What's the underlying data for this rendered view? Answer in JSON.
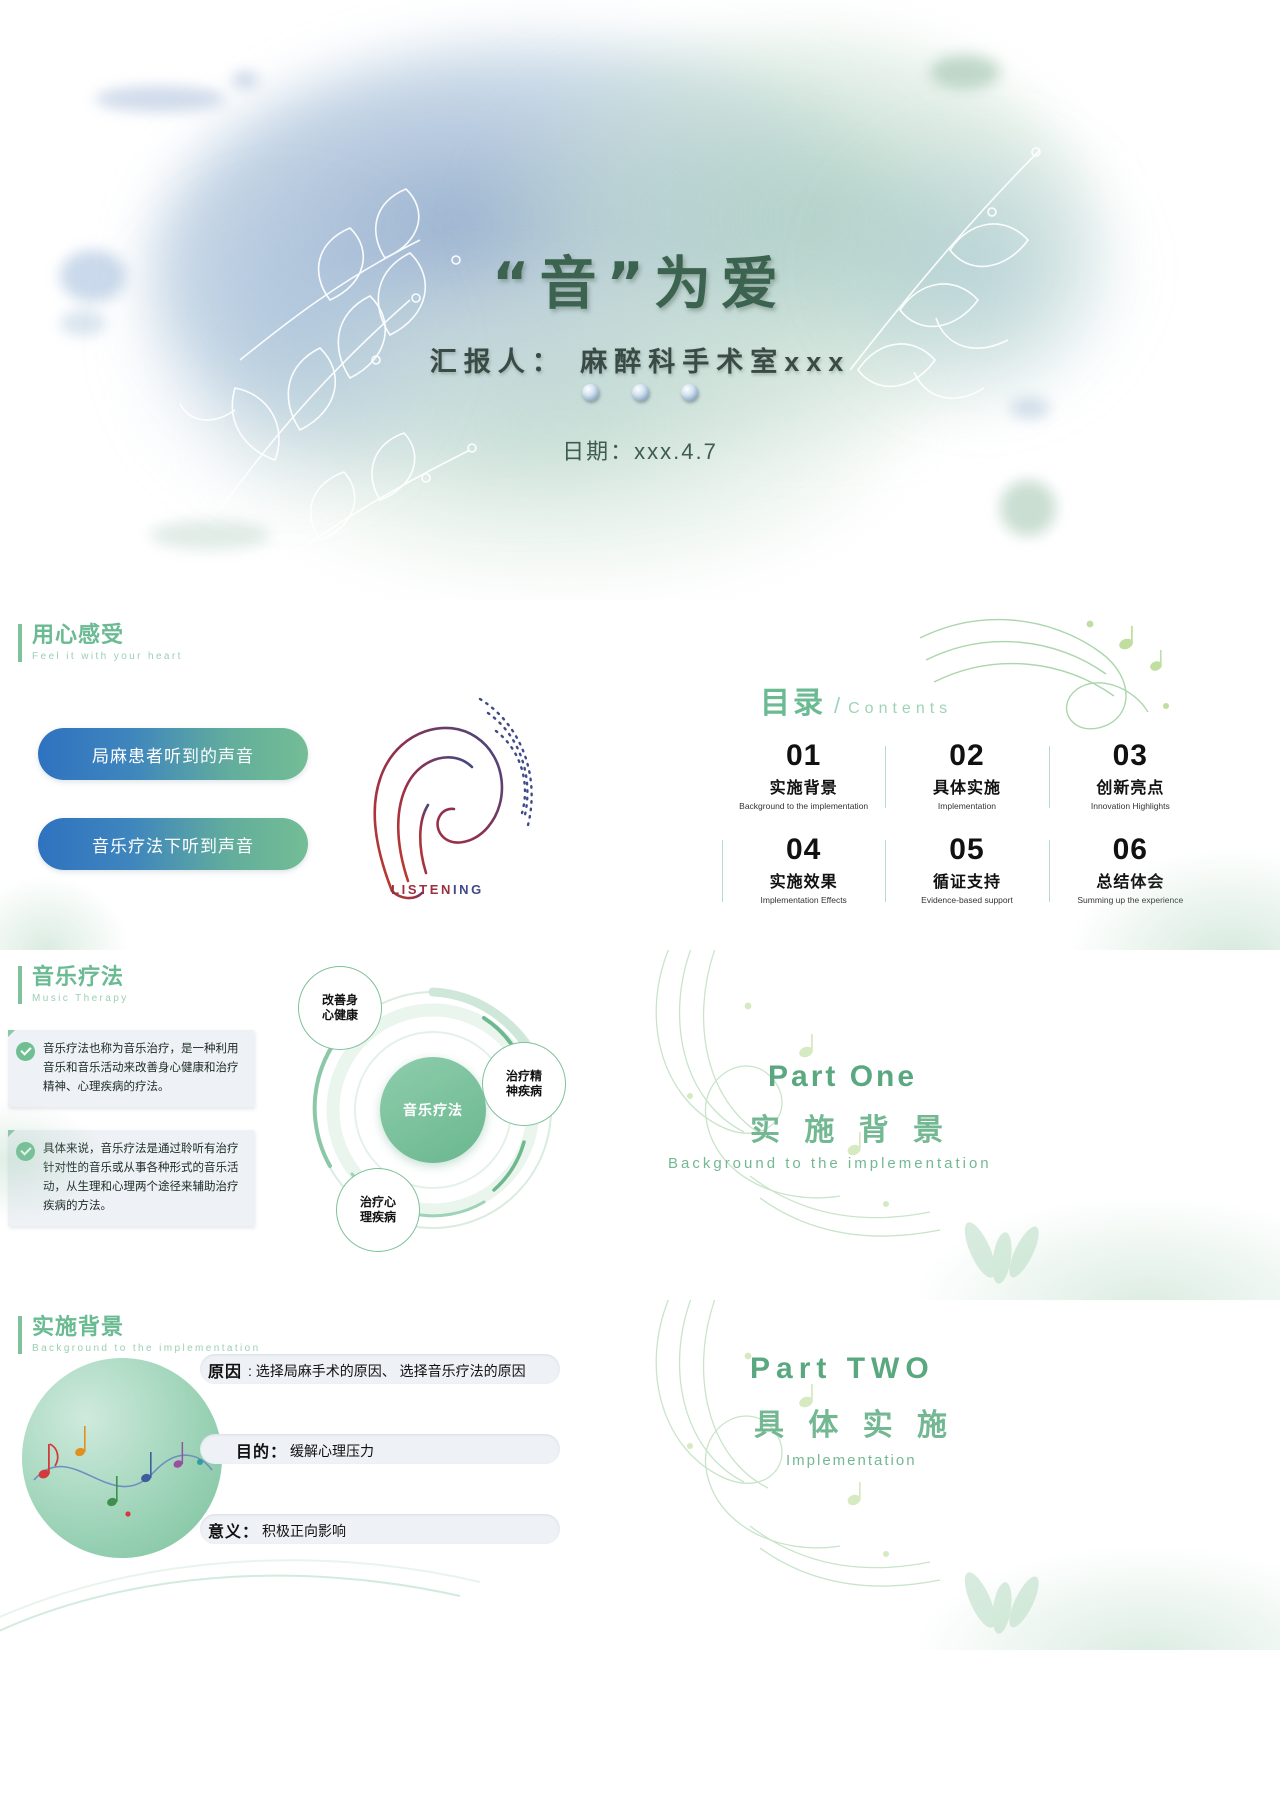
{
  "cover": {
    "title": "“音”为爱",
    "presenter": "汇报人： 麻醉科手术室xxx",
    "date": "日期：xxx.4.7",
    "accent": "#3c6350"
  },
  "feel": {
    "heading_zh": "用心感受",
    "heading_en": "Feel it with your heart",
    "pills": [
      "局麻患者听到的声音",
      "音乐疗法下听到声音"
    ],
    "ear_caption_a": "LISTEN",
    "ear_caption_b": "ING",
    "pill_gradient_from": "#2f72c0",
    "pill_gradient_to": "#74bd96"
  },
  "toc": {
    "title_zh": "目录",
    "slash": "/",
    "title_en": "Contents",
    "items": [
      {
        "num": "01",
        "zh": "实施背景",
        "en": "Background to the implementation"
      },
      {
        "num": "02",
        "zh": "具体实施",
        "en": "Implementation"
      },
      {
        "num": "03",
        "zh": "创新亮点",
        "en": "Innovation Highlights"
      },
      {
        "num": "04",
        "zh": "实施效果",
        "en": "Implementation Effects"
      },
      {
        "num": "05",
        "zh": "循证支持",
        "en": "Evidence-based support"
      },
      {
        "num": "06",
        "zh": "总结体会",
        "en": "Summing up the experience"
      }
    ],
    "accent": "#6aba92"
  },
  "music_therapy": {
    "heading_zh": "音乐疗法",
    "heading_en": "Music Therapy",
    "cards": [
      "音乐疗法也称为音乐治疗，是一种利用音乐和音乐活动来改善身心健康和治疗精神、心理疾病的疗法。",
      "具体来说，音乐疗法是通过聆听有治疗针对性的音乐或从事各种形式的音乐活动，从生理和心理两个途径来辅助治疗疾病的方法。"
    ],
    "diagram": {
      "center": "音乐疗法",
      "nodes": [
        "改善身\n心健康",
        "治疗精\n神疾病",
        "治疗心\n理疾病"
      ]
    }
  },
  "part_one": {
    "en_title": "Part One",
    "zh_title": "实 施 背 景",
    "desc": "Background to the implementation"
  },
  "background": {
    "heading_zh": "实施背景",
    "heading_en": "Background to the implementation",
    "rows": [
      {
        "label": "原因",
        "value": ": 选择局麻手术的原因、 选择音乐疗法的原因"
      },
      {
        "label": "目的：",
        "value": "缓解心理压力"
      },
      {
        "label": "意义：",
        "value": "积极正向影响"
      }
    ]
  },
  "part_two": {
    "en_title": "Part TWO",
    "zh_title": "具 体 实 施",
    "desc": "Implementation"
  },
  "theme": {
    "green": "#6aba92",
    "green_light": "#9ed3b6",
    "green_dark": "#3c6350",
    "blue": "#2f72c0",
    "text_dark": "#111111"
  }
}
